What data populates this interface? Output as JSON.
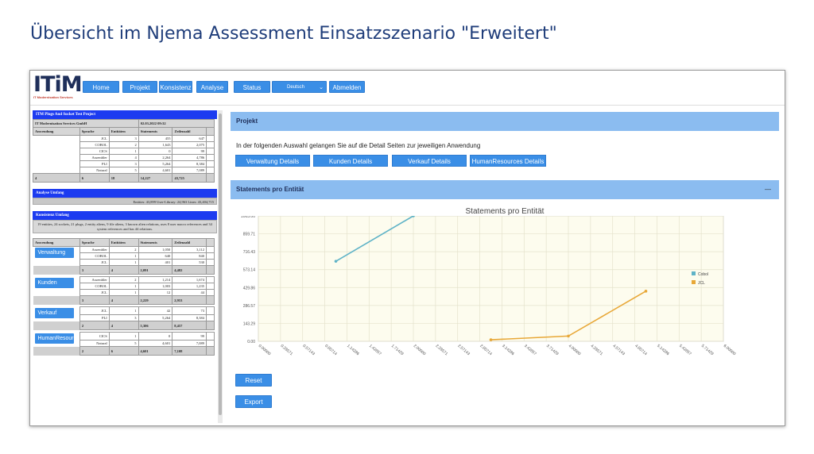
{
  "slide": {
    "title": "Übersicht im Njema Assessment Einsatzszenario \"Erweitert\""
  },
  "logo": {
    "main": "ITiM",
    "subtitle": "IT Modernisation Services"
  },
  "nav": {
    "home": "Home",
    "projekt": "Projekt",
    "konsistenz": "Konsistenz",
    "analyse": "Analyse",
    "status": "Status",
    "language": "Deutsch",
    "logout": "Abmelden"
  },
  "project": {
    "title": "ITM Plugs And Socket Test Project",
    "company": "IT Modernisation Services GmbH",
    "date": "02.03.2022 09:32",
    "headers": [
      "Anwendung",
      "Sprache",
      "Entitäten",
      "Statements",
      "Zeilenzahl"
    ],
    "rows": [
      [
        "JCL",
        "3",
        "455",
        "647"
      ],
      [
        "COBOL",
        "2",
        "1,643",
        "2,075"
      ],
      [
        "CICS",
        "1",
        "0",
        "99"
      ],
      [
        "Assembler",
        "4",
        "2,264",
        "4,786"
      ],
      [
        "PLI",
        "3",
        "5,264",
        "8,384"
      ],
      [
        "Natural",
        "5",
        "4,601",
        "7,089"
      ]
    ],
    "totals": [
      "4",
      "6",
      "18",
      "14,227",
      "43,725"
    ]
  },
  "analyse": {
    "title": "Analyse Umfang",
    "summary": "Entities: 43,899 User-Library: 24,963 Lines: 43,404,715"
  },
  "konsistenz": {
    "title": "Konsistenz Umfang",
    "summary": "19 entities, 24 sockets, 21 plugs, 2 entity aliens, 9 file aliens, 3 known alien relations, uses 8 user macro references and 34 system references and has 44 relations.",
    "headers": [
      "Anwendung",
      "Sprache",
      "Entitäten",
      "Statements",
      "Zeilenzahl"
    ],
    "apps": [
      {
        "name": "Verwaltung",
        "rows": [
          [
            "Assembler",
            "2",
            "1,050",
            "3,112"
          ],
          [
            "COBOL",
            "1",
            "640",
            "840"
          ],
          [
            "JCL",
            "1",
            "401",
            "530"
          ]
        ],
        "totals": [
          "3",
          "4",
          "2,091",
          "4,482"
        ]
      },
      {
        "name": "Kunden",
        "rows": [
          [
            "Assembler",
            "2",
            "1,214",
            "1,674"
          ],
          [
            "COBOL",
            "1",
            "1,003",
            "1,235"
          ],
          [
            "JCL",
            "1",
            "12",
            "44"
          ]
        ],
        "totals": [
          "3",
          "4",
          "2,229",
          "2,953"
        ]
      },
      {
        "name": "Verkauf",
        "rows": [
          [
            "JCL",
            "1",
            "42",
            "73"
          ],
          [
            "PLI",
            "3",
            "5,264",
            "8,384"
          ]
        ],
        "totals": [
          "2",
          "4",
          "5,306",
          "8,457"
        ]
      },
      {
        "name": "HumanResources",
        "rows": [
          [
            "CICS",
            "1",
            "0",
            "99"
          ],
          [
            "Natural",
            "5",
            "4,601",
            "7,089"
          ]
        ],
        "totals": [
          "2",
          "6",
          "4,601",
          "7,108"
        ]
      }
    ]
  },
  "right": {
    "projekt_title": "Projekt",
    "info": "In der folgenden Auswahl gelangen Sie auf die Detail Seiten zur jeweiligen Anwendung",
    "detail_buttons": [
      "Verwaltung Details",
      "Kunden Details",
      "Verkauf Details",
      "HumanResources Details"
    ],
    "statements_title": "Statements pro Entität",
    "collapse": "—",
    "reset": "Reset",
    "export": "Export"
  },
  "chart_data": {
    "type": "line",
    "title": "Statements pro Entität",
    "x_ticks": [
      "0.00000",
      "0.28571",
      "0.57143",
      "0.85714",
      "1.14286",
      "1.42857",
      "1.71429",
      "2.00000",
      "2.28571",
      "2.57143",
      "2.85714",
      "3.14286",
      "3.42857",
      "3.71429",
      "4.00000",
      "4.28571",
      "4.57143",
      "4.85714",
      "5.14286",
      "5.42857",
      "5.71429",
      "6.00000"
    ],
    "y_ticks": [
      "0.00",
      "143.29",
      "286.57",
      "429.86",
      "573.14",
      "716.43",
      "859.71",
      "1003.00"
    ],
    "xlim": [
      0,
      6
    ],
    "ylim": [
      0,
      1003
    ],
    "series": [
      {
        "name": "Cobol",
        "color": "#5fb3c7",
        "points": [
          [
            1.0,
            640
          ],
          [
            2.0,
            1003
          ]
        ]
      },
      {
        "name": "JCL",
        "color": "#e8a838",
        "points": [
          [
            3.0,
            12
          ],
          [
            4.0,
            42
          ],
          [
            5.0,
            401
          ]
        ]
      }
    ],
    "legend_position": "right",
    "background": "#fdfcee"
  }
}
